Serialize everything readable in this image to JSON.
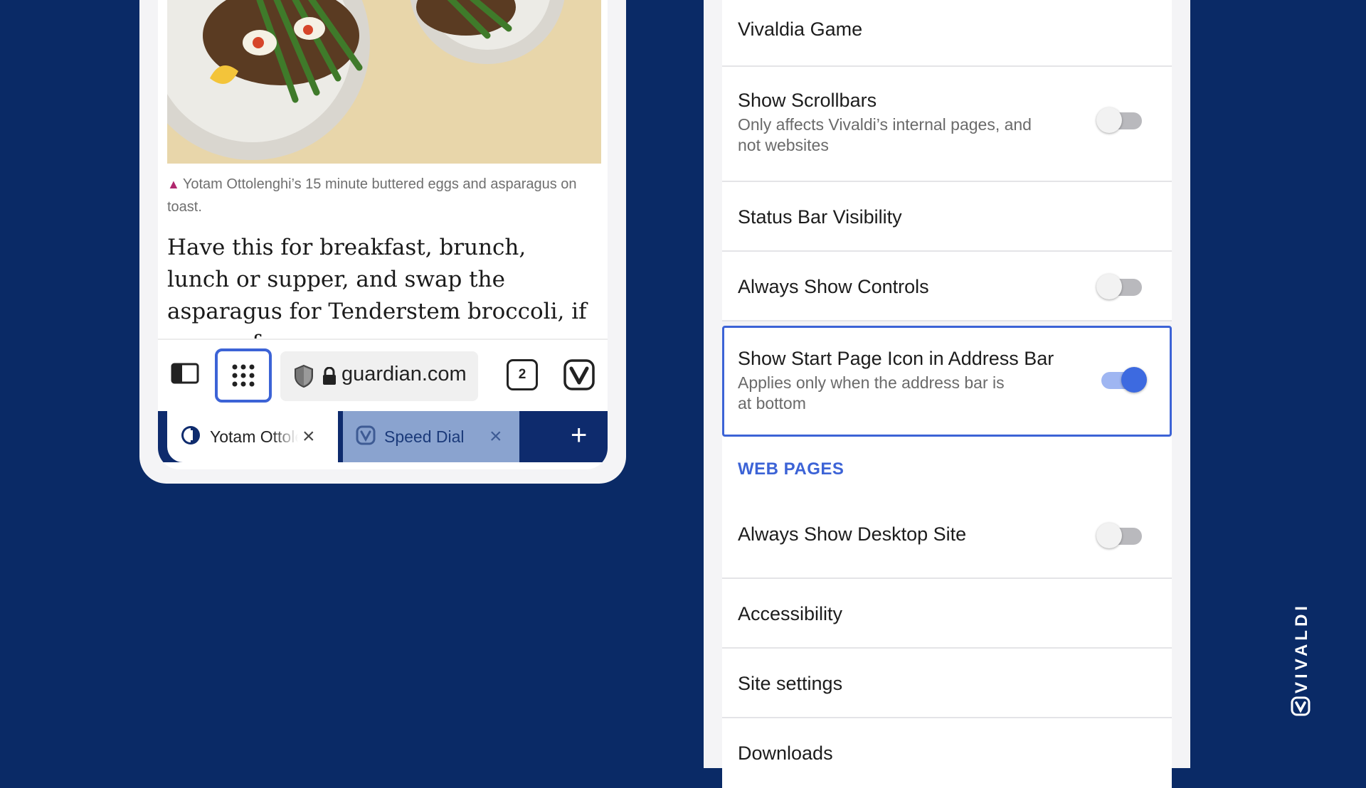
{
  "phone": {
    "caption": "Yotam Ottolenghi’s 15 minute buttered eggs and asparagus on toast.",
    "article_text": "Have this for breakfast, brunch, lunch or supper, and swap the asparagus for Tenderstem broccoli, if you prefer.",
    "toolbar": {
      "url": "guardian.com",
      "tab_count": "2"
    },
    "tabs": [
      {
        "label": "Yotam Ottolenghi",
        "close": "×",
        "icon": "guardian-icon",
        "active": true
      },
      {
        "label": "Speed Dial",
        "close": "×",
        "icon": "vivaldi-icon",
        "active": false
      }
    ],
    "add_tab": "+"
  },
  "settings": {
    "rows": {
      "vivaldia_game": {
        "title": "Vivaldia Game"
      },
      "show_scrollbars": {
        "title": "Show Scrollbars",
        "sub": "Only affects Vivaldi’s internal pages, and not websites",
        "on": false
      },
      "status_bar": {
        "title": "Status Bar Visibility"
      },
      "always_show_controls": {
        "title": "Always Show Controls",
        "on": false
      },
      "start_page_icon": {
        "title": "Show Start Page Icon in Address Bar",
        "sub": "Applies only when the address bar is at bottom",
        "on": true
      },
      "web_pages_header": "WEB PAGES",
      "desktop_site": {
        "title": "Always Show Desktop Site",
        "on": false
      },
      "accessibility": {
        "title": "Accessibility"
      },
      "site_settings": {
        "title": "Site settings"
      },
      "downloads": {
        "title": "Downloads"
      }
    }
  },
  "brand": {
    "name": "VIVALDI"
  },
  "colors": {
    "background": "#0a2a66",
    "accent": "#3c63d6",
    "tab_bar": "#0e2b6d"
  }
}
